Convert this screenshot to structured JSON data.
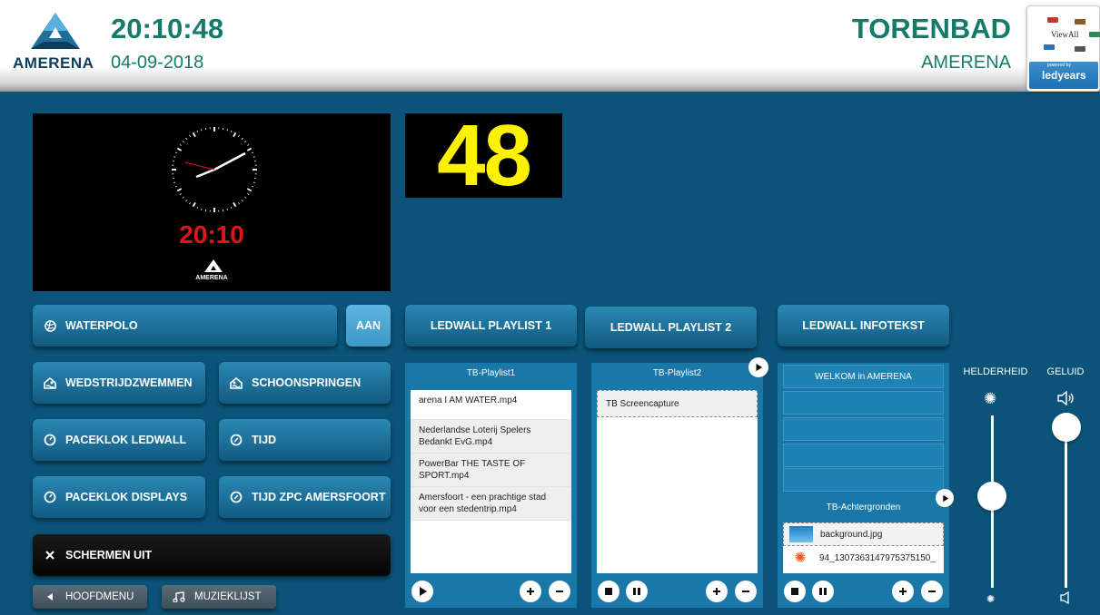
{
  "header": {
    "logo_text": "AMERENA",
    "time": "20:10:48",
    "date": "04-09-2018",
    "venue": "TORENBAD",
    "venue_sub": "AMERENA",
    "viewall_label": "ViewAll",
    "powered_by": "powered by",
    "ledyears": "ledyears"
  },
  "preview": {
    "digital_time": "20:10",
    "logo_text": "AMERENA"
  },
  "score": "48",
  "modes": {
    "waterpolo": "WATERPOLO",
    "aan": "AAN",
    "wedstrijdzwemmen": "WEDSTRIJDZWEMMEN",
    "schoonspringen": "SCHOONSPRINGEN",
    "paceklok_ledwall": "PACEKLOK LEDWALL",
    "tijd": "TIJD",
    "paceklok_displays": "PACEKLOK DISPLAYS",
    "tijd_zpc": "TIJD ZPC AMERSFOORT",
    "schermen_uit": "SCHERMEN UIT",
    "hoofdmenu": "HOOFDMENU",
    "muzieklijst": "MUZIEKLIJST"
  },
  "tabs": {
    "playlist1": "LEDWALL PLAYLIST 1",
    "playlist2": "LEDWALL PLAYLIST 2",
    "infotekst": "LEDWALL INFOTEKST"
  },
  "playlist1": {
    "title": "TB-Playlist1",
    "items": [
      "arena I AM WATER.mp4",
      "Nederlandse Loterij  Spelers Bedankt  EvG.mp4",
      "PowerBar THE TASTE OF SPORT.mp4",
      "Amersfoort - een prachtige stad voor een stedentrip.mp4"
    ]
  },
  "playlist2": {
    "title": "TB-Playlist2",
    "items": [
      "TB Screencapture"
    ]
  },
  "infotekst": {
    "lines": [
      "WELKOM in AMERENA",
      "",
      "",
      "",
      ""
    ],
    "bg_title": "TB-Achtergronden",
    "bg_items": [
      "background.jpg",
      "94_1307363147975375150_"
    ]
  },
  "sliders": {
    "brightness_label": "HELDERHEID",
    "volume_label": "GELUID",
    "brightness_level": 0.53,
    "volume_level": 0.93
  },
  "colors": {
    "background": "#0b5378",
    "accent_green": "#167a6b",
    "score_yellow": "#fff200",
    "digital_red": "#e2141c"
  },
  "icons": [
    "volleyball-icon",
    "swimmer-icon",
    "diver-icon",
    "stopwatch-icon",
    "clock-icon",
    "close-icon",
    "arrow-left-icon",
    "music-icon",
    "play-icon",
    "stop-icon",
    "pause-icon",
    "plus-icon",
    "minus-icon",
    "sun-icon",
    "speaker-icon"
  ]
}
